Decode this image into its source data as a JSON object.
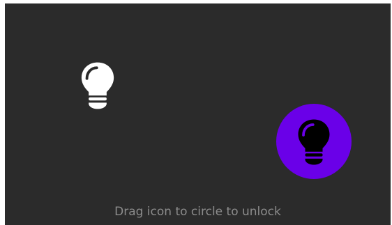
{
  "drag_icon": {
    "name": "lightbulb-icon",
    "color": "#ffffff"
  },
  "target": {
    "name": "lightbulb-icon",
    "circle_color": "#6a00e8",
    "icon_color": "#000000"
  },
  "colors": {
    "background": "#2b2b2b",
    "hint_text": "#8c8c8c"
  },
  "hint_text": "Drag icon to circle to unlock"
}
